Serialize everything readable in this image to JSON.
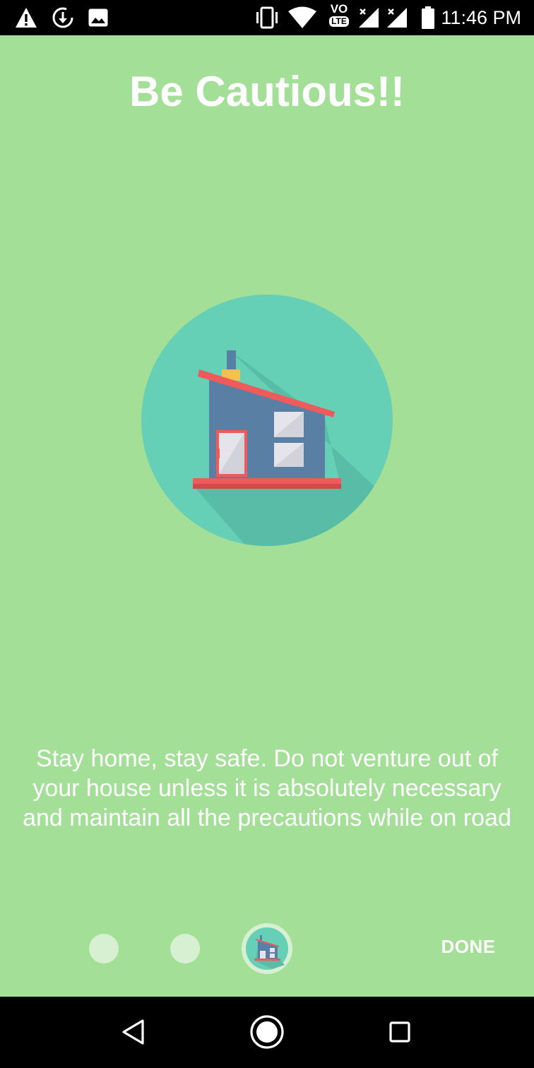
{
  "status_bar": {
    "time": "11:46 PM",
    "network_badge": "LTE",
    "volte_label": "VO",
    "icons": [
      "warning-icon",
      "sync-icon",
      "image-icon",
      "vibrate-icon",
      "wifi-icon",
      "volte-icon",
      "signal-icon",
      "signal-icon",
      "battery-icon"
    ]
  },
  "main": {
    "title": "Be Cautious!!",
    "description": "Stay home, stay safe. Do not venture out of your house unless it is absolutely necessary and maintain all the precautions while on road",
    "hero_icon": "house-icon"
  },
  "pager": {
    "page_count": 3,
    "current_page": 3,
    "done_label": "DONE"
  },
  "nav_bar": {
    "icons": [
      "back-icon",
      "home-icon",
      "recents-icon"
    ]
  },
  "colors": {
    "background": "#a3df97",
    "circle": "#66d0b7",
    "house_wall": "#5a7fa5",
    "roof": "#ef5b5b",
    "text": "#ffffff"
  }
}
